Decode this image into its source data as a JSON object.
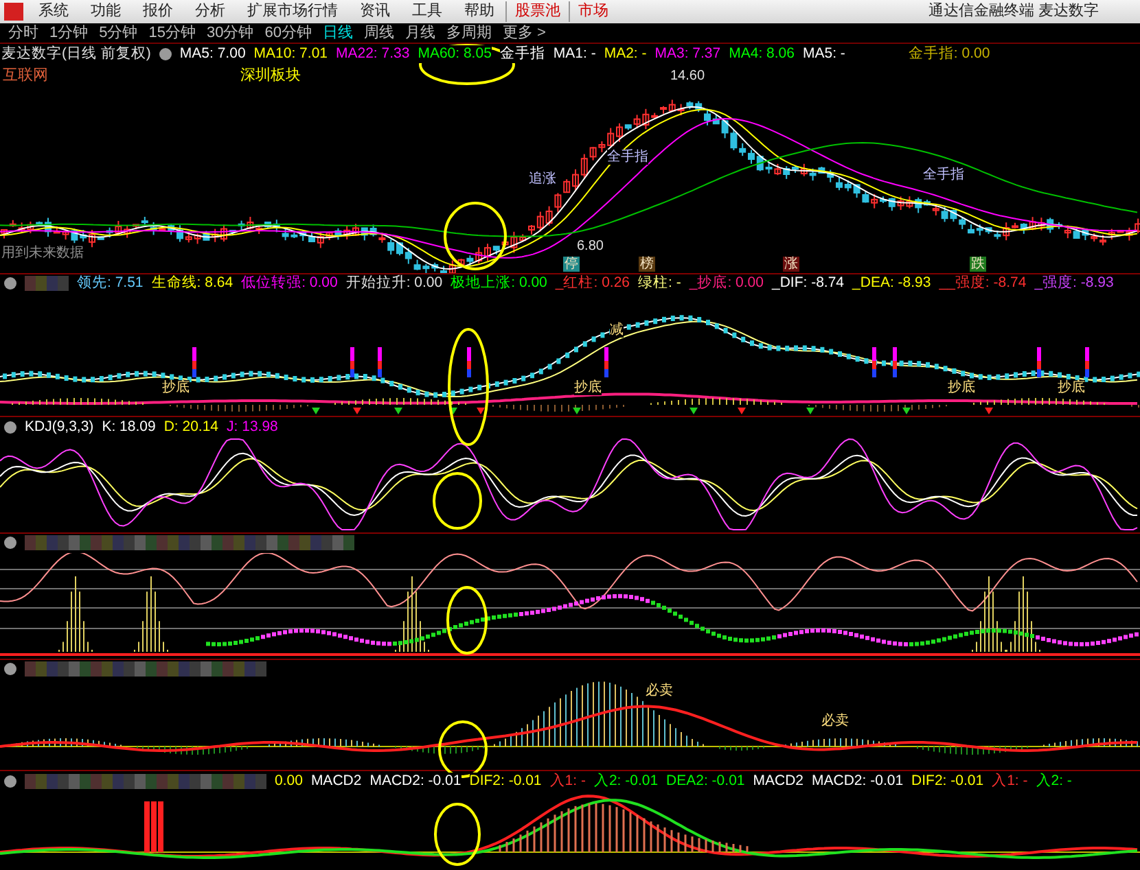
{
  "menu": {
    "items": [
      {
        "label": "系统",
        "highlighted": false
      },
      {
        "label": "功能",
        "highlighted": false
      },
      {
        "label": "报价",
        "highlighted": false
      },
      {
        "label": "分析",
        "highlighted": false
      },
      {
        "label": "扩展市场行情",
        "highlighted": false
      },
      {
        "label": "资讯",
        "highlighted": false
      },
      {
        "label": "工具",
        "highlighted": false
      },
      {
        "label": "帮助",
        "highlighted": false
      },
      {
        "label": "股票池",
        "highlighted": true
      },
      {
        "label": "市场",
        "highlighted": true
      }
    ],
    "app_title": "通达信金融终端 麦达数字"
  },
  "periods": [
    {
      "label": "分时",
      "selected": false
    },
    {
      "label": "1分钟",
      "selected": false
    },
    {
      "label": "5分钟",
      "selected": false
    },
    {
      "label": "15分钟",
      "selected": false
    },
    {
      "label": "30分钟",
      "selected": false
    },
    {
      "label": "60分钟",
      "selected": false
    },
    {
      "label": "日线",
      "selected": true
    },
    {
      "label": "周线",
      "selected": false
    },
    {
      "label": "月线",
      "selected": false
    },
    {
      "label": "多周期",
      "selected": false
    },
    {
      "label": "更多 >",
      "selected": false
    }
  ],
  "main_chart": {
    "title": "麦达数字(日线 前复权)",
    "indicators": [
      {
        "text": "MA5: 7.00",
        "color": "#ffffff"
      },
      {
        "text": "MA10: 7.01",
        "color": "#ffff00"
      },
      {
        "text": "MA22: 7.33",
        "color": "#ff00ff"
      },
      {
        "text": "MA60: 8.05",
        "color": "#00ff00"
      },
      {
        "text": "金手指",
        "color": "#ffffff"
      },
      {
        "text": "MA1: -",
        "color": "#ffffff"
      },
      {
        "text": "MA2: -",
        "color": "#ffff00"
      },
      {
        "text": "MA3: 7.37",
        "color": "#ff00ff"
      },
      {
        "text": "MA4: 8.06",
        "color": "#00ff00"
      },
      {
        "text": "MA5: -",
        "color": "#ffffff"
      },
      {
        "text": "金手指: 0.00",
        "color": "#c8b400"
      }
    ],
    "sector_tags": [
      {
        "text": "互联网",
        "color": "#e0603a"
      },
      {
        "text": "深圳板块",
        "color": "#ffff00"
      }
    ],
    "price_labels": [
      "14.60",
      "6.80"
    ],
    "annotations": [
      "追涨",
      "全手指",
      "全手指"
    ],
    "warning": "用到未来数据",
    "signals": [
      {
        "text": "停",
        "color": "#1f8a8a"
      },
      {
        "text": "榜",
        "color": "#5a3a10"
      },
      {
        "text": "涨",
        "color": "#6a0e0e"
      },
      {
        "text": "跌",
        "color": "#1e7a1e"
      }
    ]
  },
  "panels": [
    {
      "kind": "signal",
      "header_obscured": true,
      "readings": [
        {
          "text": "领先: 7.51",
          "color": "#66ccff"
        },
        {
          "text": "生命线: 8.64",
          "color": "#ffff00"
        },
        {
          "text": "低位转强: 0.00",
          "color": "#ff00ff"
        },
        {
          "text": "开始拉升: 0.00",
          "color": "#e0e0e0"
        },
        {
          "text": "极地上涨: 0.00",
          "color": "#00ff00"
        },
        {
          "text": "_红柱: 0.26",
          "color": "#ff3030"
        },
        {
          "text": "绿柱: -",
          "color": "#ffff80"
        },
        {
          "text": "_抄底: 0.00",
          "color": "#ff2080"
        },
        {
          "text": "_DIF: -8.74",
          "color": "#ffffff"
        },
        {
          "text": "_DEA: -8.93",
          "color": "#ffff00"
        },
        {
          "text": "__强度: -8.74",
          "color": "#ff3030"
        },
        {
          "text": "_强度: -8.93",
          "color": "#cc44ff"
        }
      ],
      "annotations": [
        "减",
        "抄底",
        "抄底",
        "抄底",
        "抄底"
      ]
    },
    {
      "kind": "kdj",
      "header_obscured": false,
      "readings": [
        {
          "text": "KDJ(9,3,3)",
          "color": "#ffffff"
        },
        {
          "text": "K: 18.09",
          "color": "#ffffff"
        },
        {
          "text": "D: 20.14",
          "color": "#ffff00"
        },
        {
          "text": "J: 13.98",
          "color": "#ff00ff"
        }
      ]
    },
    {
      "kind": "oscillator",
      "header_obscured": true
    },
    {
      "kind": "histogram",
      "header_obscured": true,
      "annotations": [
        "必卖",
        "必卖"
      ]
    },
    {
      "kind": "macd",
      "header_obscured": true,
      "readings": [
        {
          "text": "0.00",
          "color": "#ffff00"
        },
        {
          "text": "MACD2",
          "color": "#ffffff"
        },
        {
          "text": "MACD2: -0.01",
          "color": "#ffffff"
        },
        {
          "text": "DIF2: -0.01",
          "color": "#ffff00"
        },
        {
          "text": "入1: -",
          "color": "#ff3030"
        },
        {
          "text": "入2: -0.01",
          "color": "#00ff00"
        },
        {
          "text": "DEA2: -0.01",
          "color": "#00ff00"
        },
        {
          "text": "MACD2",
          "color": "#ffffff"
        },
        {
          "text": "MACD2: -0.01",
          "color": "#ffffff"
        },
        {
          "text": "DIF2: -0.01",
          "color": "#ffff00"
        },
        {
          "text": "入1: -",
          "color": "#ff3030"
        },
        {
          "text": "入2: -",
          "color": "#00ff00"
        }
      ]
    }
  ]
}
